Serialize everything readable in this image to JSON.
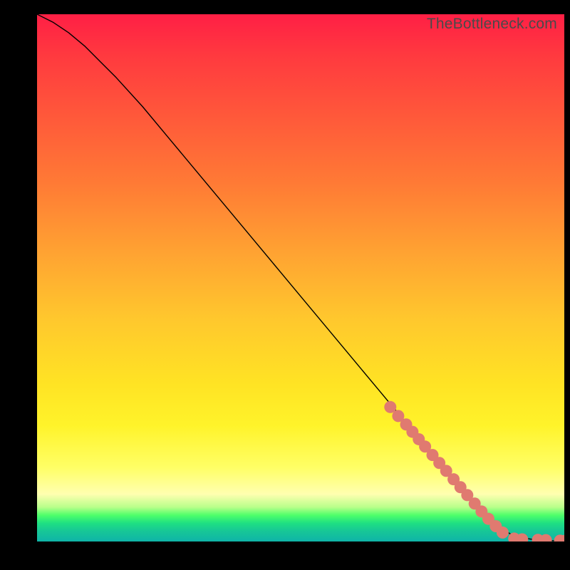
{
  "watermark": "TheBottleneck.com",
  "colors": {
    "marker": "#e07a70",
    "line": "#000000"
  },
  "chart_data": {
    "type": "line",
    "title": "",
    "xlabel": "",
    "ylabel": "",
    "xlim": [
      0,
      100
    ],
    "ylim": [
      0,
      100
    ],
    "grid": false,
    "legend": false,
    "series": [
      {
        "name": "curve",
        "x": [
          0,
          3,
          6,
          9,
          12,
          15,
          20,
          25,
          30,
          35,
          40,
          45,
          50,
          55,
          60,
          65,
          70,
          75,
          80,
          83,
          86,
          88,
          90,
          92,
          94,
          96,
          98,
          100
        ],
        "y": [
          100,
          98.5,
          96.5,
          94,
          91,
          88,
          82.5,
          76.5,
          70.5,
          64.5,
          58.5,
          52.5,
          46.5,
          40.5,
          34.5,
          28.5,
          22.5,
          16.5,
          10.5,
          7,
          4,
          2.5,
          1.3,
          0.7,
          0.4,
          0.25,
          0.15,
          0.1
        ]
      }
    ],
    "markers": [
      {
        "x": 67,
        "y": 25.5
      },
      {
        "x": 68.5,
        "y": 23.8
      },
      {
        "x": 70,
        "y": 22.2
      },
      {
        "x": 71.2,
        "y": 20.8
      },
      {
        "x": 72.4,
        "y": 19.4
      },
      {
        "x": 73.6,
        "y": 18.0
      },
      {
        "x": 75,
        "y": 16.4
      },
      {
        "x": 76.3,
        "y": 14.9
      },
      {
        "x": 77.6,
        "y": 13.4
      },
      {
        "x": 79,
        "y": 11.8
      },
      {
        "x": 80.3,
        "y": 10.3
      },
      {
        "x": 81.6,
        "y": 8.8
      },
      {
        "x": 83,
        "y": 7.2
      },
      {
        "x": 84.3,
        "y": 5.7
      },
      {
        "x": 85.6,
        "y": 4.3
      },
      {
        "x": 87,
        "y": 2.9
      },
      {
        "x": 88.3,
        "y": 1.7
      },
      {
        "x": 90.5,
        "y": 0.55
      },
      {
        "x": 92,
        "y": 0.4
      },
      {
        "x": 95,
        "y": 0.3
      },
      {
        "x": 96.5,
        "y": 0.25
      },
      {
        "x": 99.2,
        "y": 0.15
      },
      {
        "x": 100,
        "y": 0.1
      }
    ]
  }
}
